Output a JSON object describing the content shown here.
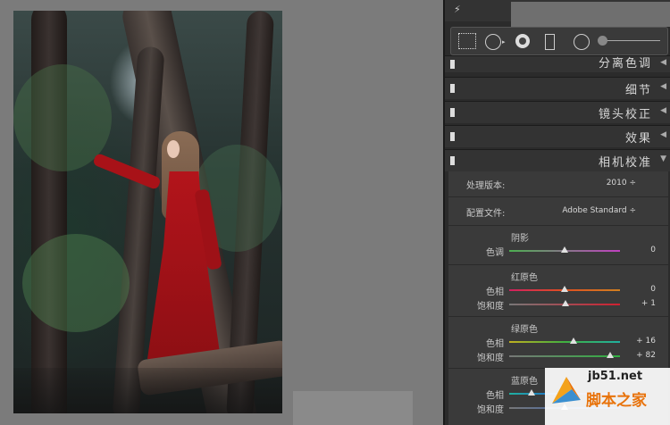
{
  "panel": {
    "sections": [
      {
        "label": "分离色调",
        "arrow": "◀"
      },
      {
        "label": "细节",
        "arrow": "◀"
      },
      {
        "label": "镜头校正",
        "arrow": "◀"
      },
      {
        "label": "效果",
        "arrow": "◀"
      },
      {
        "label": "相机校准",
        "arrow": "▼"
      }
    ],
    "process": {
      "label": "处理版本:",
      "value": "2010 ÷"
    },
    "profile": {
      "label": "配置文件:",
      "value": "Adobe Standard ÷"
    },
    "shadows": {
      "title": "阴影",
      "tint_label": "色调",
      "tint_value": "0",
      "tint_pos": 0.5
    },
    "red": {
      "title": "红原色",
      "hue_label": "色相",
      "hue_value": "0",
      "hue_pos": 0.5,
      "sat_label": "饱和度",
      "sat_value": "+ 1",
      "sat_pos": 0.505
    },
    "green": {
      "title": "绿原色",
      "hue_label": "色相",
      "hue_value": "+ 16",
      "hue_pos": 0.58,
      "sat_label": "饱和度",
      "sat_value": "+ 82",
      "sat_pos": 0.91
    },
    "blue": {
      "title": "蓝原色",
      "hue_label": "色相",
      "hue_value": "",
      "hue_pos": 0.2,
      "sat_label": "饱和度",
      "sat_value": "",
      "sat_pos": 0.5
    }
  },
  "icons": [
    "flash-icon",
    "grid-tool-icon",
    "circle-tool-icon",
    "redeye-tool-icon",
    "rect-tool-icon",
    "round-tool-icon"
  ],
  "watermark": {
    "url": "jb51.net",
    "name": "脚本之家"
  },
  "colors": {
    "panel_bg": "#2b2b2b",
    "content_bg": "#3a3a3a",
    "canvas_bg": "#7b7b7b",
    "dress_red": "#b3141b"
  }
}
